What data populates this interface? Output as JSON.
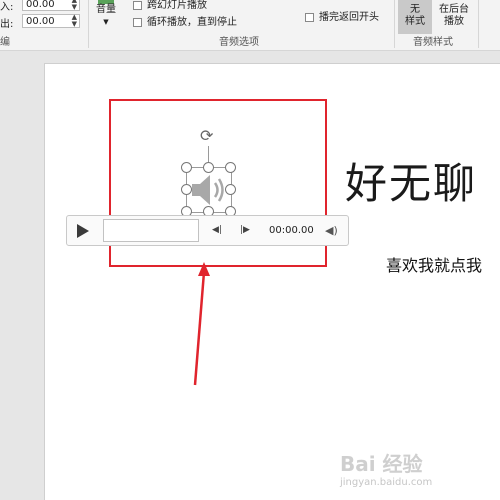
{
  "ribbon": {
    "fade_in_label": "入:",
    "fade_in_value": "00.00",
    "fade_out_label": "出:",
    "fade_out_value": "00.00",
    "edit_group_label": "编",
    "volume_label": "音量",
    "cross_slide_label": "跨幻灯片播放",
    "loop_label": "循环播放，直到停止",
    "rewind_label": "播完返回开头",
    "audio_options_label": "音频选项",
    "no_style_line1": "无",
    "no_style_line2": "样式",
    "play_bg_line1": "在后台",
    "play_bg_line2": "播放",
    "audio_styles_label": "音频样式"
  },
  "slide": {
    "title": "好无聊",
    "subtitle": "喜欢我就点我"
  },
  "player": {
    "time": "00:00.00"
  },
  "watermark": {
    "brand": "Bai 经验",
    "site": "jingyan.baidu.com"
  },
  "colors": {
    "highlight": "#e0242d",
    "ribbon_bg": "#f3f3f3",
    "selected_style_bg": "#c9c9c9"
  }
}
